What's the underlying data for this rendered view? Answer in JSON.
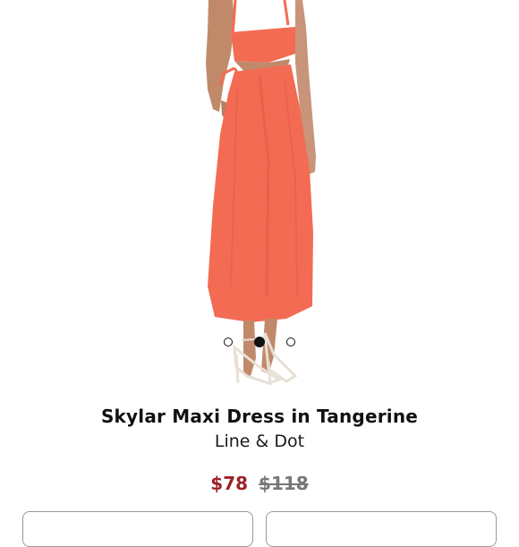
{
  "product": {
    "title": "Skylar Maxi Dress in Tangerine",
    "brand": "Line & Dot",
    "price_sale": "$78",
    "price_original": "$118"
  },
  "gallery": {
    "image_count": 3,
    "active_index": 1
  },
  "colors": {
    "dress": "#f36b53",
    "sale_price": "#9b2226"
  }
}
